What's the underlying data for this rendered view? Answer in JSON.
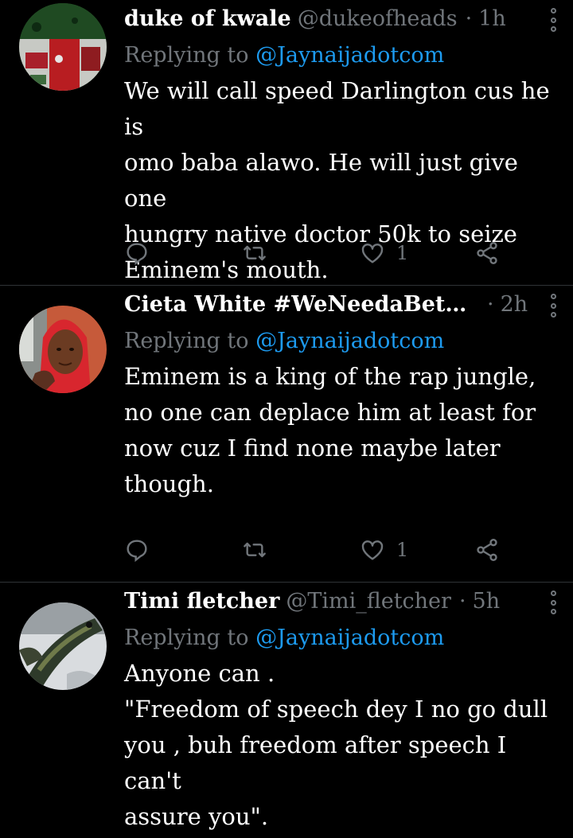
{
  "tweets": [
    {
      "name": "duke of kwale",
      "handle": "@dukeofheads",
      "sep": "·",
      "time": "1h",
      "replying_prefix": "Replying to ",
      "replying_to": "@Jaynaijadotcom",
      "text": "We will call speed Darlington cus he is\nomo baba alawo. He will just give one\nhungry native doctor 50k to seize\nEminem's mouth.",
      "likes": "1",
      "avatar_icon": "nigerian-flag-avatar"
    },
    {
      "name": "Cieta White #WeNeedaBette...",
      "handle": "",
      "sep": "·",
      "time": "2h",
      "replying_prefix": "Replying to ",
      "replying_to": "@Jaynaijadotcom",
      "text": "Eminem is a king of the  rap jungle,\nno one can deplace  him at least for\nnow cuz I find none maybe later\nthough.",
      "likes": "1",
      "avatar_icon": "woman-portrait-avatar"
    },
    {
      "name": "Timi fletcher",
      "handle": "@Timi_fletcher",
      "sep": "·",
      "time": "5h",
      "replying_prefix": "Replying to ",
      "replying_to": "@Jaynaijadotcom",
      "text": "Anyone can .\n\"Freedom of speech dey I no go dull\nyou , buh freedom after speech I can't\nassure you\".",
      "avatar_icon": "fish-avatar"
    }
  ],
  "colors": {
    "background": "#000000",
    "text": "#ffffff",
    "muted": "#71767b",
    "mention": "#1d9bf0",
    "divider": "#2f3336"
  }
}
